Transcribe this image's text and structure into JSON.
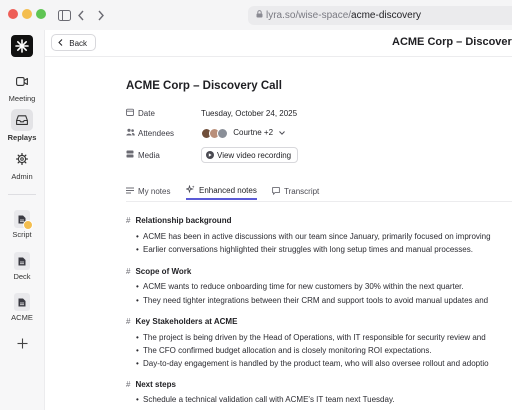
{
  "browser": {
    "url_host": "lyra.so/wise-space/",
    "url_path": "acme-discovery"
  },
  "sidebar": {
    "items": [
      {
        "label": "Meeting",
        "icon": "video-camera-icon"
      },
      {
        "label": "Replays",
        "icon": "inbox-tray-icon",
        "active": true
      },
      {
        "label": "Admin",
        "icon": "gear-icon"
      },
      {
        "label": "Script",
        "icon": "document-icon"
      },
      {
        "label": "Deck",
        "icon": "document-icon"
      },
      {
        "label": "ACME",
        "icon": "document-icon"
      }
    ]
  },
  "topbar": {
    "back_label": "Back",
    "title": "ACME Corp – Discovery C"
  },
  "page": {
    "title": "ACME Corp – Discovery Call",
    "date_label": "Date",
    "date_value": "Tuesday, October 24, 2025",
    "attendees_label": "Attendees",
    "attendees_value": "Courtne +2",
    "media_label": "Media",
    "media_button": "View video recording"
  },
  "tabs": [
    {
      "label": "My notes",
      "icon": "list-icon"
    },
    {
      "label": "Enhanced notes",
      "icon": "sparkle-icon",
      "active": true
    },
    {
      "label": "Transcript",
      "icon": "chat-icon"
    }
  ],
  "sections": [
    {
      "heading": "Relationship background",
      "bullets": [
        "ACME has been in active discussions with our team since January, primarily focused on improving",
        "Earlier conversations highlighted their struggles with long setup times and manual processes."
      ]
    },
    {
      "heading": "Scope of Work",
      "bullets": [
        "ACME wants to reduce onboarding time for new customers by 30% within the next quarter.",
        "They need tighter integrations between their CRM and support tools to avoid manual updates and"
      ]
    },
    {
      "heading": "Key Stakeholders at ACME",
      "bullets": [
        "The project is being driven by the Head of Operations, with IT responsible for security review and",
        "The CFO confirmed budget allocation and is closely monitoring ROI expectations.",
        "Day-to-day engagement is handled by the product team, who will also oversee rollout and adoptio"
      ]
    },
    {
      "heading": "Next steps",
      "bullets": [
        "Schedule a technical validation call with ACME's IT team next Tuesday."
      ]
    }
  ],
  "colors": {
    "accent": "#5b5bd6",
    "traffic_red": "#ee5e57",
    "traffic_yellow": "#f4be4f",
    "traffic_green": "#5fc553"
  }
}
